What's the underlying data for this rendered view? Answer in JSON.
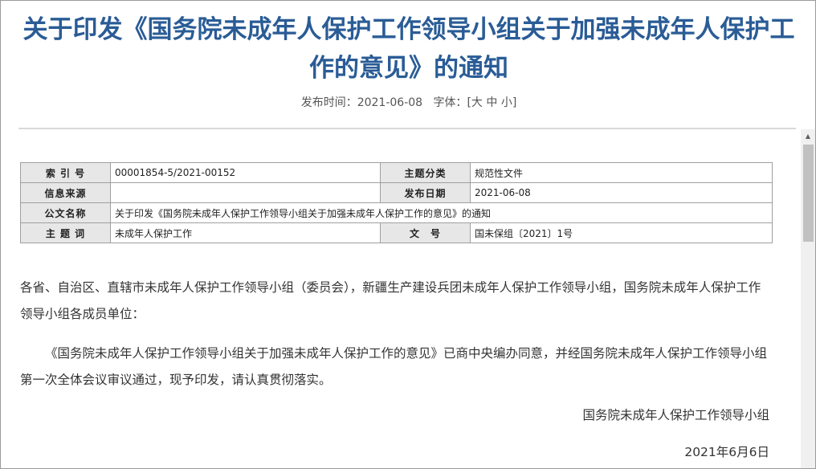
{
  "article": {
    "title_line1": "关于印发《国务院未成年人保护工作领导小组关于加强未成年人保护工",
    "title_line2": "作的意见》的通知",
    "publish_label": "发布时间：",
    "publish_date": "2021-06-08",
    "font_size_label": "字体：",
    "font_size_open": "[",
    "font_large": "大",
    "font_medium": "中",
    "font_small": "小",
    "font_size_close": "]"
  },
  "info_table": {
    "index_label": "索 引 号",
    "index_value": "00001854-5/2021-00152",
    "category_label": "主题分类",
    "category_value": "规范性文件",
    "source_label": "信息来源",
    "source_value": "",
    "date_label": "发布日期",
    "date_value": "2021-06-08",
    "doc_name_label": "公文名称",
    "doc_name_value": "关于印发《国务院未成年人保护工作领导小组关于加强未成年人保护工作的意见》的通知",
    "keywords_label": "主 题 词",
    "keywords_value": "未成年人保护工作",
    "doc_no_label": "文　号",
    "doc_no_value": "国未保组〔2021〕1号"
  },
  "body": {
    "paragraph1": "各省、自治区、直辖市未成年人保护工作领导小组（委员会），新疆生产建设兵团未成年人保护工作领导小组，国务院未成年人保护工作领导小组各成员单位：",
    "paragraph2": "《国务院未成年人保护工作领导小组关于加强未成年人保护工作的意见》已商中央编办同意，并经国务院未成年人保护工作领导小组第一次全体会议审议通过，现予印发，请认真贯彻落实。",
    "signature": "国务院未成年人保护工作领导小组",
    "sign_date": "2021年6月6日"
  },
  "theme": {
    "title_color": "#2a5c96",
    "label_bg": "#e7e7e7"
  },
  "icons": {
    "scroll_up": "up-arrow-icon"
  }
}
